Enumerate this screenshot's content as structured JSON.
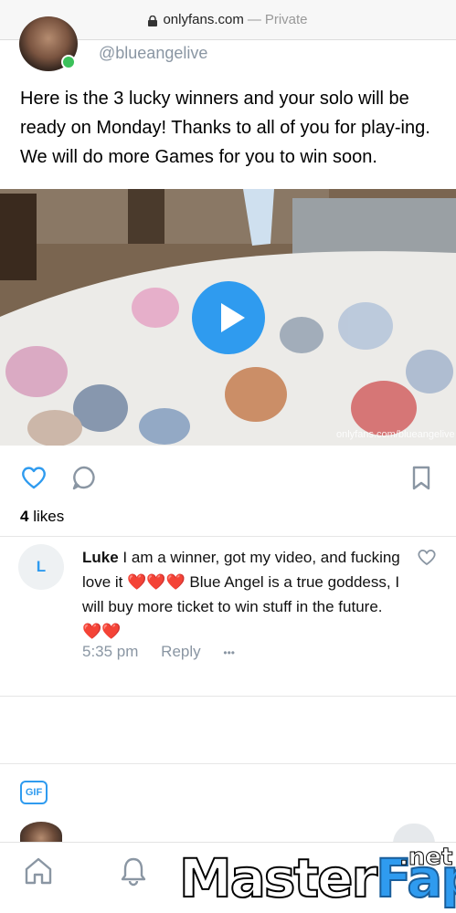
{
  "browser": {
    "host": "onlyfans.com",
    "separator": "—",
    "mode": "Private"
  },
  "post": {
    "handle": "@blueangelive",
    "text": "Here is the 3 lucky winners and your solo will be ready on Monday! Thanks to all of you for play-ing. We will do more Games for you to win soon.",
    "media_watermark": "onlyfans.com/blueangelive",
    "likes_count": "4",
    "likes_label": "likes"
  },
  "comment": {
    "avatar_initial": "L",
    "author": "Luke",
    "text_part1": "I am a winner, got my video, and fucking love it",
    "hearts1": "❤️❤️❤️",
    "text_part2": "Blue Angel is a true goddess, I will buy more ticket to win stuff in the future.",
    "hearts2": "❤️❤️",
    "time": "5:35 pm",
    "reply_label": "Reply",
    "more": "•••"
  },
  "composer": {
    "gif_label": "GIF"
  },
  "overlay_brand": {
    "word1": "Master",
    "word2": "Fap",
    "suffix": ".net"
  },
  "colors": {
    "accent": "#2f9bef",
    "online": "#3bc15a",
    "muted": "#8a96a3",
    "heart": "#e2262b"
  }
}
